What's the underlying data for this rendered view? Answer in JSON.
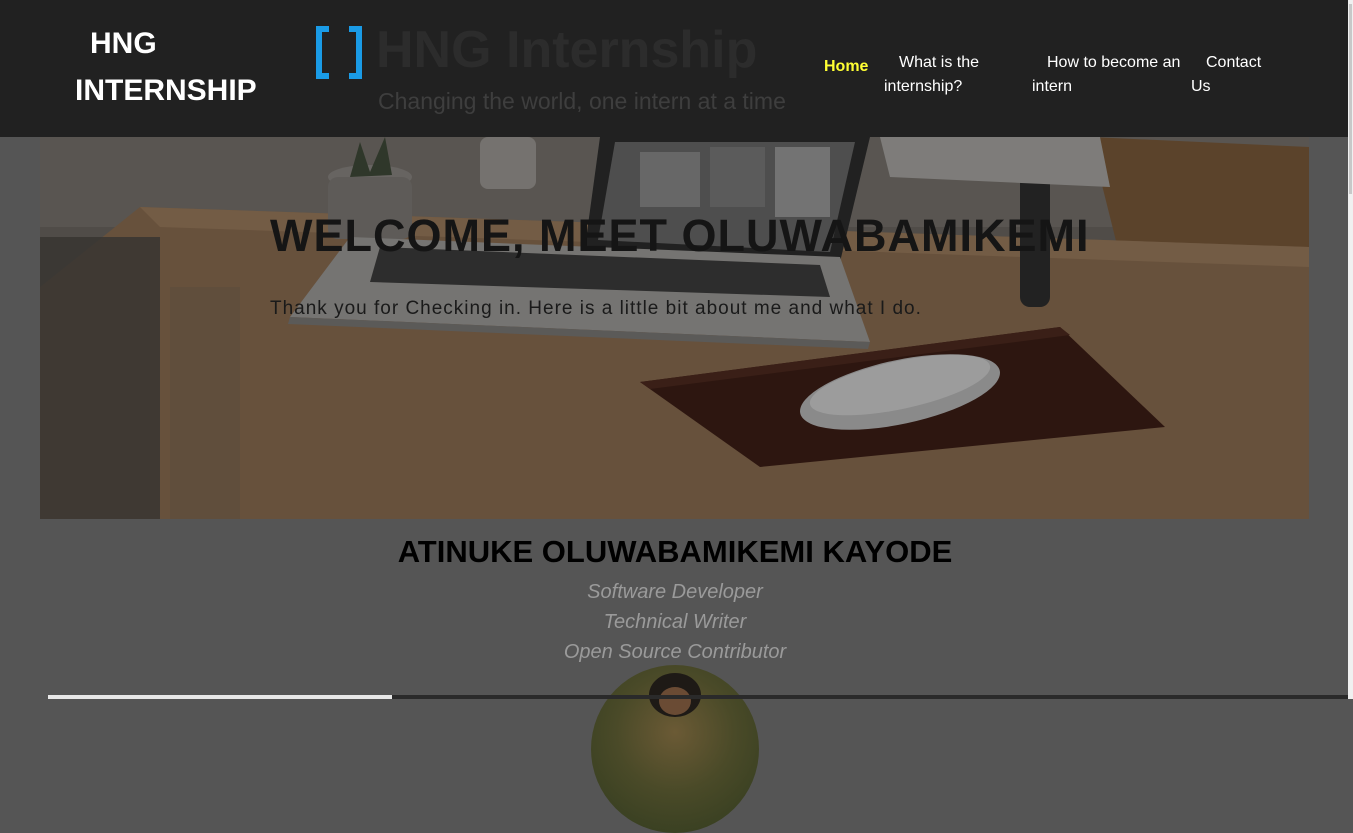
{
  "brand": {
    "line1": "HNG",
    "line2": "INTERNSHIP"
  },
  "logo": {
    "title": "HNG Internship",
    "tagline": "Changing the world, one intern at a time",
    "accent": "#1a9be6"
  },
  "nav": {
    "home": "Home",
    "what": "What is the internship?",
    "how": "How to become an intern",
    "contact": "Contact Us",
    "active_color": "#ffff33"
  },
  "hero": {
    "title": "WELCOME, MEET OLUWABAMIKEMI",
    "subtitle": "Thank you for Checking in. Here is a little bit about me and what I do."
  },
  "profile": {
    "name": "ATINUKE OLUWABAMIKEMI KAYODE",
    "roles": [
      "Software Developer",
      "Technical Writer",
      "Open Source Contributor"
    ]
  }
}
